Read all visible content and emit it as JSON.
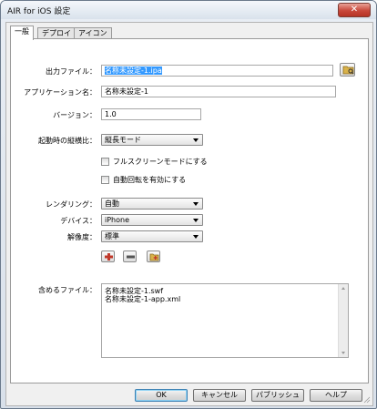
{
  "window": {
    "title": "AIR for iOS 設定",
    "close_glyph": "✕"
  },
  "tabs": [
    {
      "label": "一般",
      "active": true
    },
    {
      "label": "デプロイ",
      "active": false
    },
    {
      "label": "アイコン",
      "active": false
    }
  ],
  "form": {
    "output_file": {
      "label": "出力ファイル：",
      "value": "名称未設定-1.ipa"
    },
    "app_name": {
      "label": "アプリケーション名：",
      "value": "名称未設定-1"
    },
    "version": {
      "label": "バージョン：",
      "value": "1.0"
    },
    "aspect_ratio": {
      "label": "起動時の縦横比：",
      "value": "縦長モード"
    },
    "fullscreen": {
      "label": "フルスクリーンモードにする",
      "checked": false
    },
    "auto_orient": {
      "label": "自動回転を有効にする",
      "checked": false
    },
    "rendering": {
      "label": "レンダリング：",
      "value": "自動"
    },
    "device": {
      "label": "デバイス：",
      "value": "iPhone"
    },
    "resolution": {
      "label": "解像度：",
      "value": "標準"
    },
    "included_files": {
      "label": "含めるファイル：",
      "items": [
        "名称未設定-1.swf",
        "名称未設定-1-app.xml"
      ]
    }
  },
  "buttons": {
    "ok": "OK",
    "cancel": "キャンセル",
    "publish": "パブリッシュ",
    "help": "ヘルプ"
  },
  "icons": {
    "browse": "folder-icon",
    "add": "plus-icon",
    "remove": "minus-icon",
    "add_folder": "folder-add-icon"
  }
}
